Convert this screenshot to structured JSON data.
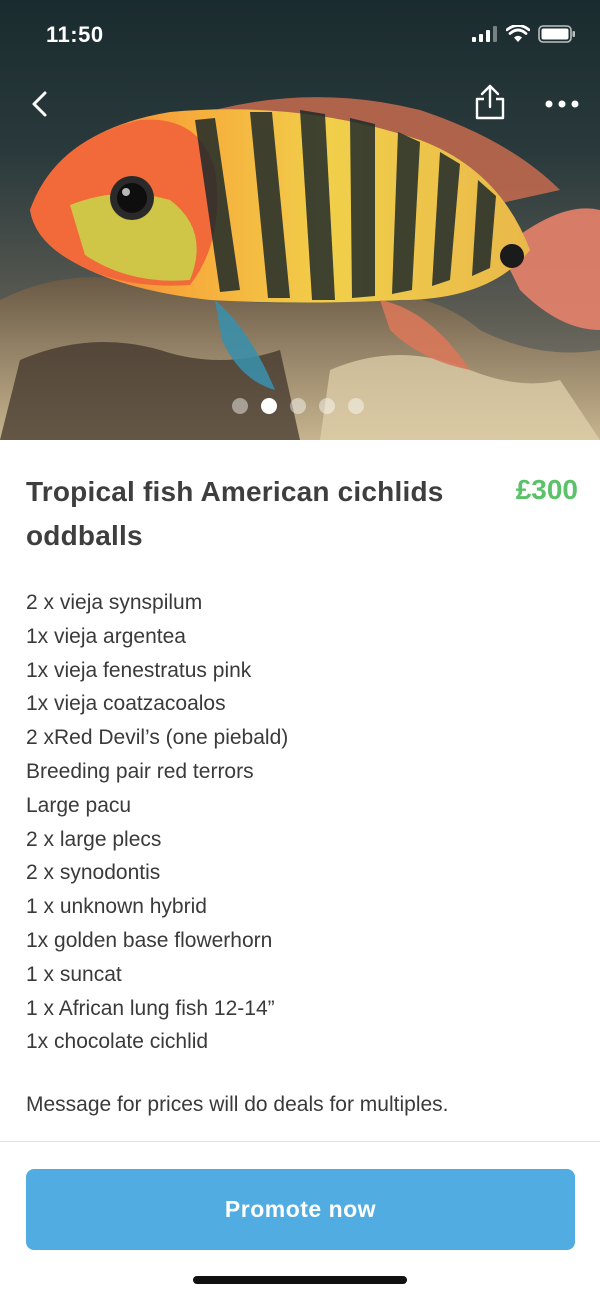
{
  "status_bar": {
    "time": "11:50"
  },
  "listing": {
    "title": "Tropical fish American cichlids oddballs",
    "price": "£300",
    "description_lines": [
      "2 x vieja synspilum",
      "1x vieja argentea",
      "1x vieja fenestratus pink",
      "1x vieja coatzacoalos",
      "2 xRed Devil’s (one piebald)",
      "Breeding pair red terrors",
      "Large pacu",
      "2 x large plecs",
      "2 x synodontis",
      "1 x unknown hybrid",
      "1x golden base flowerhorn",
      "1 x suncat",
      "1 x African lung fish 12-14”",
      "1x chocolate cichlid"
    ],
    "note": "Message for prices will do deals for multiples."
  },
  "gallery": {
    "image_count": 5,
    "active_index": 1
  },
  "actions": {
    "promote_label": "Promote now"
  },
  "icons": {
    "back": "chevron-left-icon",
    "share": "share-icon",
    "more": "more-dots-icon",
    "signal": "signal-icon",
    "wifi": "wifi-icon",
    "battery": "battery-icon"
  },
  "colors": {
    "price": "#5cc26a",
    "button": "#51ade1"
  }
}
